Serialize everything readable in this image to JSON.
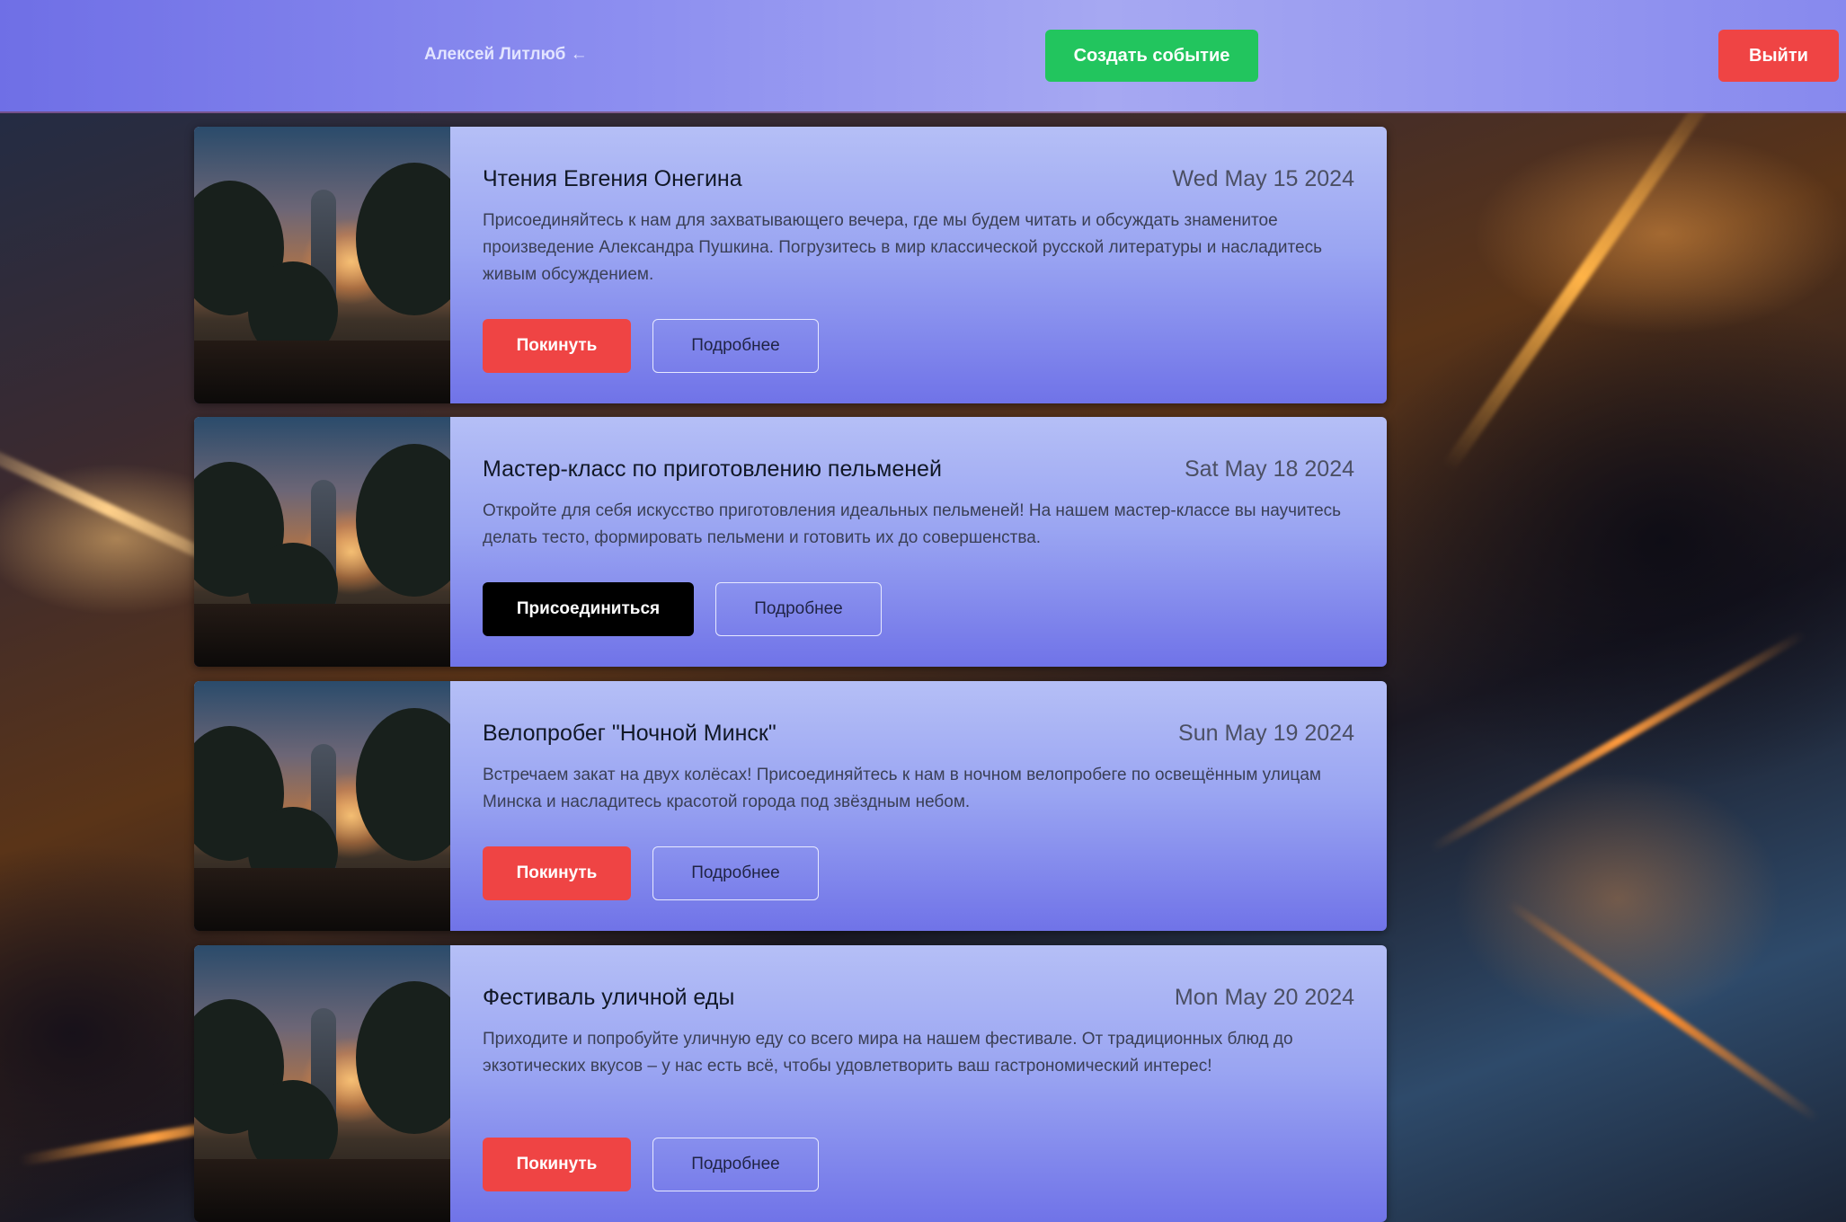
{
  "header": {
    "user_name": "Алексей Литлюб ←",
    "create_event_label": "Создать событие",
    "logout_label": "Выйти"
  },
  "events": [
    {
      "title": "Чтения Евгения Онегина",
      "date": "Wed May 15 2024",
      "description": "Присоединяйтесь к нам для захватывающего вечера, где мы будем читать и обсуждать знаменитое произведение Александра Пушкина. Погрузитесь в мир классической русской литературы и насладитесь живым обсуждением.",
      "primary_action": "Покинуть",
      "details_label": "Подробнее"
    },
    {
      "title": "Мастер-класс по приготовлению пельменей",
      "date": "Sat May 18 2024",
      "description": "Откройте для себя искусство приготовления идеальных пельменей! На нашем мастер-классе вы научитесь делать тесто, формировать пельмени и готовить их до совершенства.",
      "primary_action": "Присоединиться",
      "details_label": "Подробнее"
    },
    {
      "title": "Велопробег \"Ночной Минск\"",
      "date": "Sun May 19 2024",
      "description": "Встречаем закат на двух колёсах! Присоединяйтесь к нам в ночном велопробеге по освещённым улицам Минска и насладитесь красотой города под звёздным небом.",
      "primary_action": "Покинуть",
      "details_label": "Подробнее"
    },
    {
      "title": "Фестиваль уличной еды",
      "date": "Mon May 20 2024",
      "description": "Приходите и попробуйте уличную еду со всего мира на нашем фестивале. От традиционных блюд до экзотических вкусов – у нас есть всё, чтобы удовлетворить ваш гастрономический интерес!",
      "primary_action": "Покинуть",
      "details_label": "Подробнее"
    }
  ],
  "colors": {
    "create": "#22c55e",
    "logout": "#ef4444",
    "leave": "#ef4444",
    "join": "#000000",
    "header_bg": "#8d8ff0",
    "card_bg": "#9aa5f2"
  }
}
